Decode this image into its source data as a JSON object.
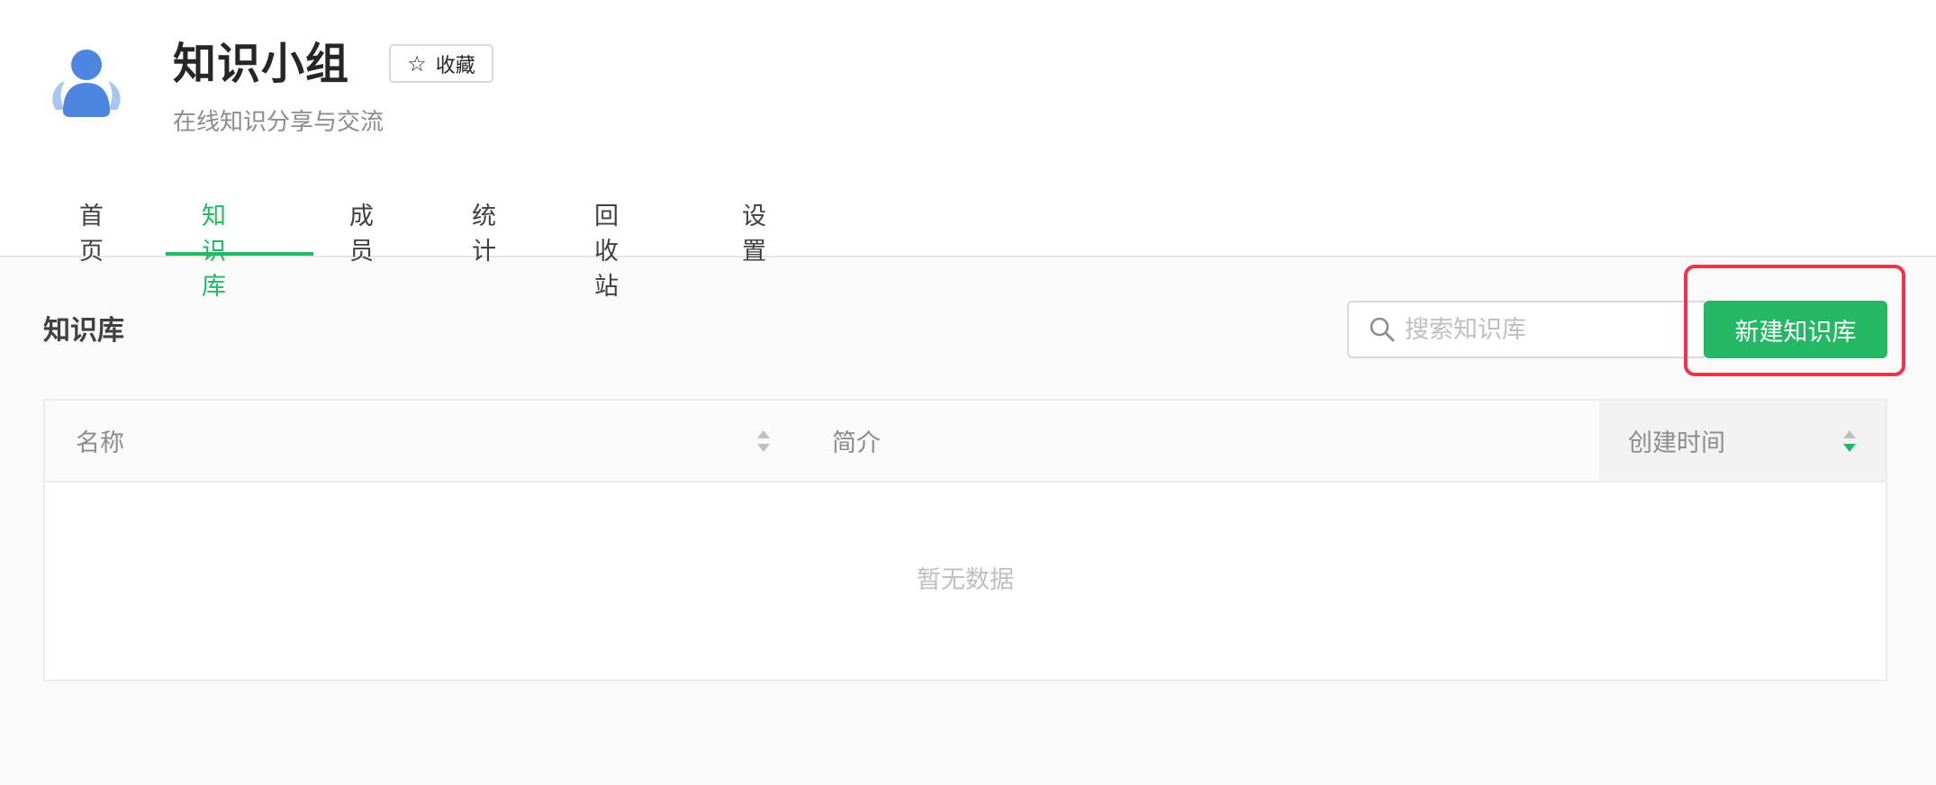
{
  "group": {
    "title": "知识小组",
    "favorite_label": "收藏",
    "description": "在线知识分享与交流"
  },
  "tabs": [
    {
      "label": "首页",
      "active": false
    },
    {
      "label": "知识库",
      "active": true
    },
    {
      "label": "成员",
      "active": false
    },
    {
      "label": "统计",
      "active": false
    },
    {
      "label": "回收站",
      "active": false
    },
    {
      "label": "设置",
      "active": false
    }
  ],
  "section": {
    "title": "知识库",
    "search_placeholder": "搜索知识库",
    "new_button_label": "新建知识库"
  },
  "table": {
    "columns": [
      {
        "label": "名称",
        "sortable": true
      },
      {
        "label": "简介",
        "sortable": false
      },
      {
        "label": "创建时间",
        "sortable": true,
        "sort": "descending"
      }
    ],
    "rows": [],
    "empty_text": "暂无数据"
  },
  "colors": {
    "accent": "#25b864",
    "highlight": "#f5304a",
    "avatar": "#4d86e0"
  },
  "icons": {
    "avatar": "user-group-icon",
    "favorite": "star-icon",
    "search": "search-icon",
    "sort": "sort-caret-icon"
  }
}
